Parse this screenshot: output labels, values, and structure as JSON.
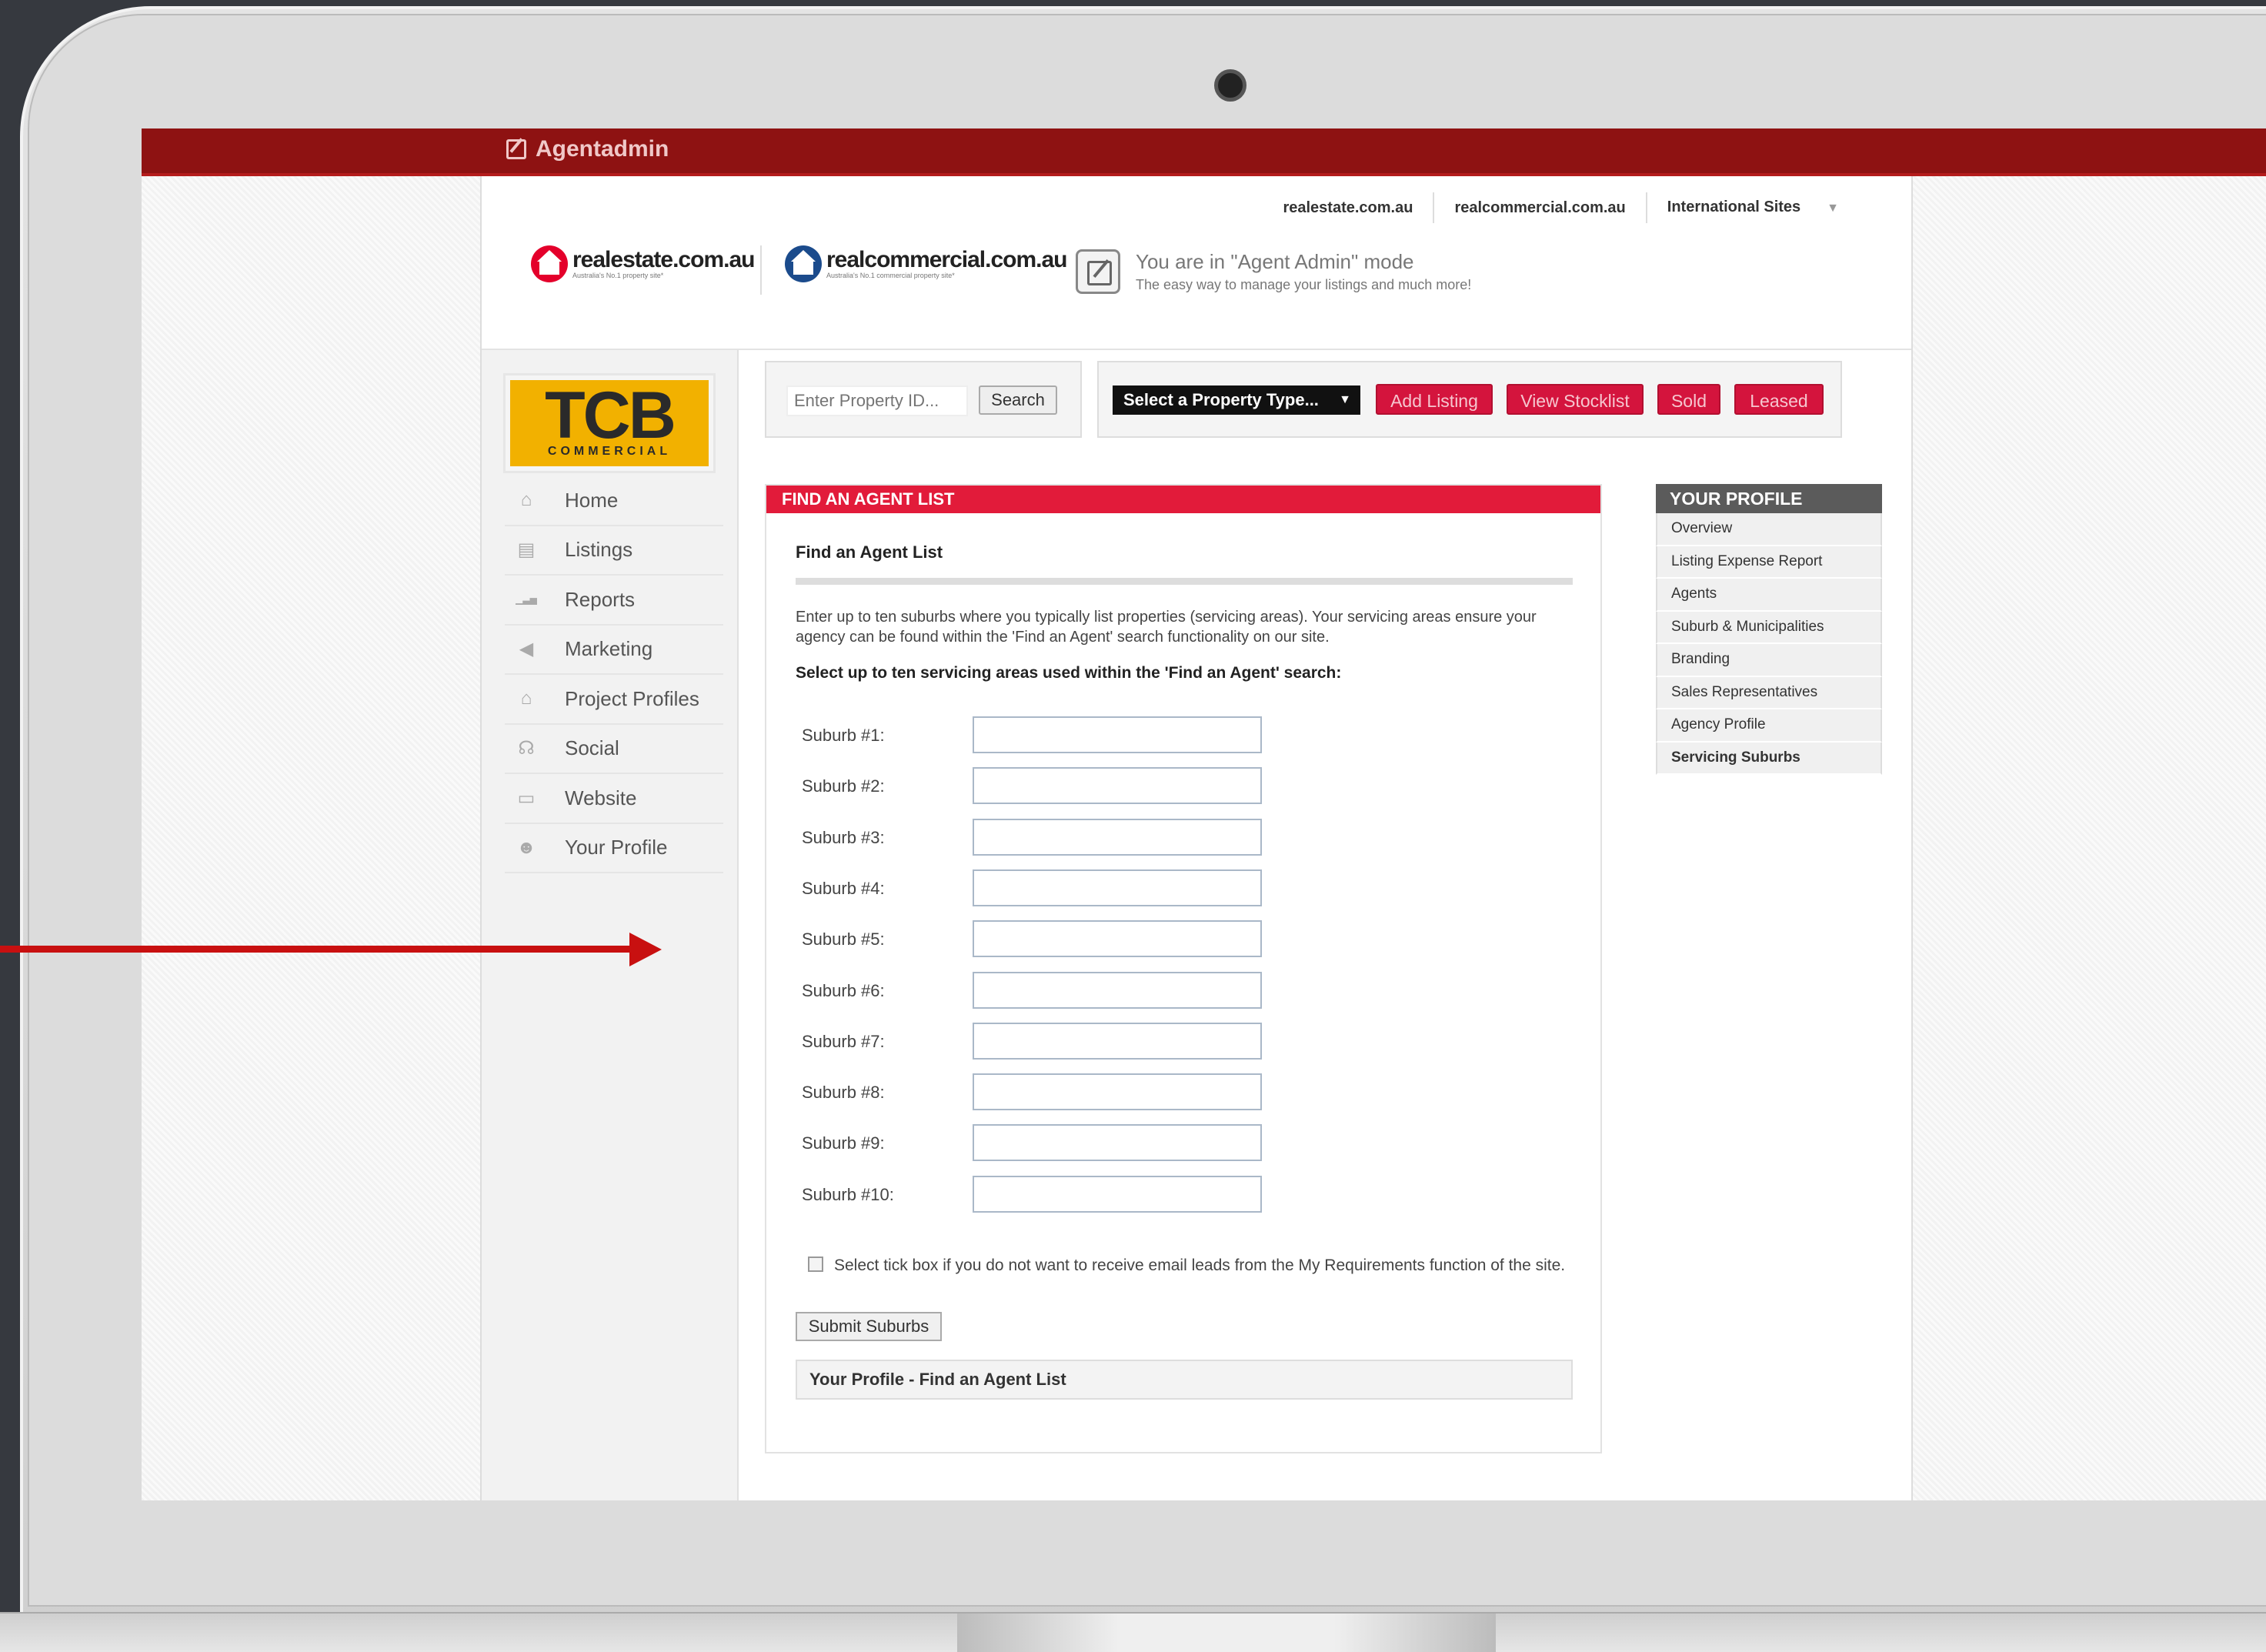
{
  "app": {
    "brand": "Agentadmin"
  },
  "header": {
    "links": [
      "realestate.com.au",
      "realcommercial.com.au",
      "International Sites"
    ],
    "logos": {
      "rea": {
        "name": "realestate.com.au",
        "tagline": "Australia's No.1 property site*"
      },
      "rca": {
        "name": "realcommercial.com.au",
        "tagline": "Australia's No.1 commercial property site*"
      }
    },
    "mode_title": "You are in \"Agent Admin\" mode",
    "mode_sub": "The easy way to manage your listings and much more!"
  },
  "agency_logo": {
    "big": "TCB",
    "small": "COMMERCIAL"
  },
  "nav": [
    {
      "label": "Home",
      "icon": "home-icon",
      "glyph": "⌂"
    },
    {
      "label": "Listings",
      "icon": "listings-icon",
      "glyph": "▤"
    },
    {
      "label": "Reports",
      "icon": "reports-icon",
      "glyph": "▁▃▅"
    },
    {
      "label": "Marketing",
      "icon": "megaphone-icon",
      "glyph": "◀"
    },
    {
      "label": "Project Profiles",
      "icon": "building-icon",
      "glyph": "⌂"
    },
    {
      "label": "Social",
      "icon": "social-icon",
      "glyph": "☊"
    },
    {
      "label": "Website",
      "icon": "monitor-icon",
      "glyph": "▭"
    },
    {
      "label": "Your Profile",
      "icon": "users-icon",
      "glyph": "☻"
    }
  ],
  "toolbar": {
    "search_placeholder": "Enter Property ID...",
    "search_label": "Search",
    "property_type": "Select a Property Type...",
    "buttons": [
      "Add Listing",
      "View Stocklist",
      "Sold",
      "Leased"
    ]
  },
  "panel": {
    "header": "FIND AN AGENT LIST",
    "subtitle": "Find an Agent List",
    "description": "Enter up to ten suburbs where you typically list properties (servicing areas). Your servicing areas ensure your agency can be found within the 'Find an Agent' search functionality on our site.",
    "instruction": "Select up to ten servicing areas used within the 'Find an Agent' search:",
    "suburb_labels": [
      "Suburb #1:",
      "Suburb #2:",
      "Suburb #3:",
      "Suburb #4:",
      "Suburb #5:",
      "Suburb #6:",
      "Suburb #7:",
      "Suburb #8:",
      "Suburb #9:",
      "Suburb #10:"
    ],
    "tickbox_text": "Select tick box if you do not want to receive email leads from the My Requirements function of the site.",
    "submit_label": "Submit Suburbs",
    "footer": "Your Profile - Find an Agent List"
  },
  "profile_menu": {
    "title": "YOUR PROFILE",
    "items": [
      "Overview",
      "Listing Expense Report",
      "Agents",
      "Suburb & Municipalities",
      "Branding",
      "Sales Representatives",
      "Agency Profile",
      "Servicing Suburbs"
    ],
    "active": "Servicing Suburbs"
  },
  "colors": {
    "topbar": "#8e1212",
    "panel_header": "#e21b3a",
    "action_button": "#d4143d",
    "agency_logo": "#f2b100",
    "annotation_arrow": "#c81010"
  }
}
